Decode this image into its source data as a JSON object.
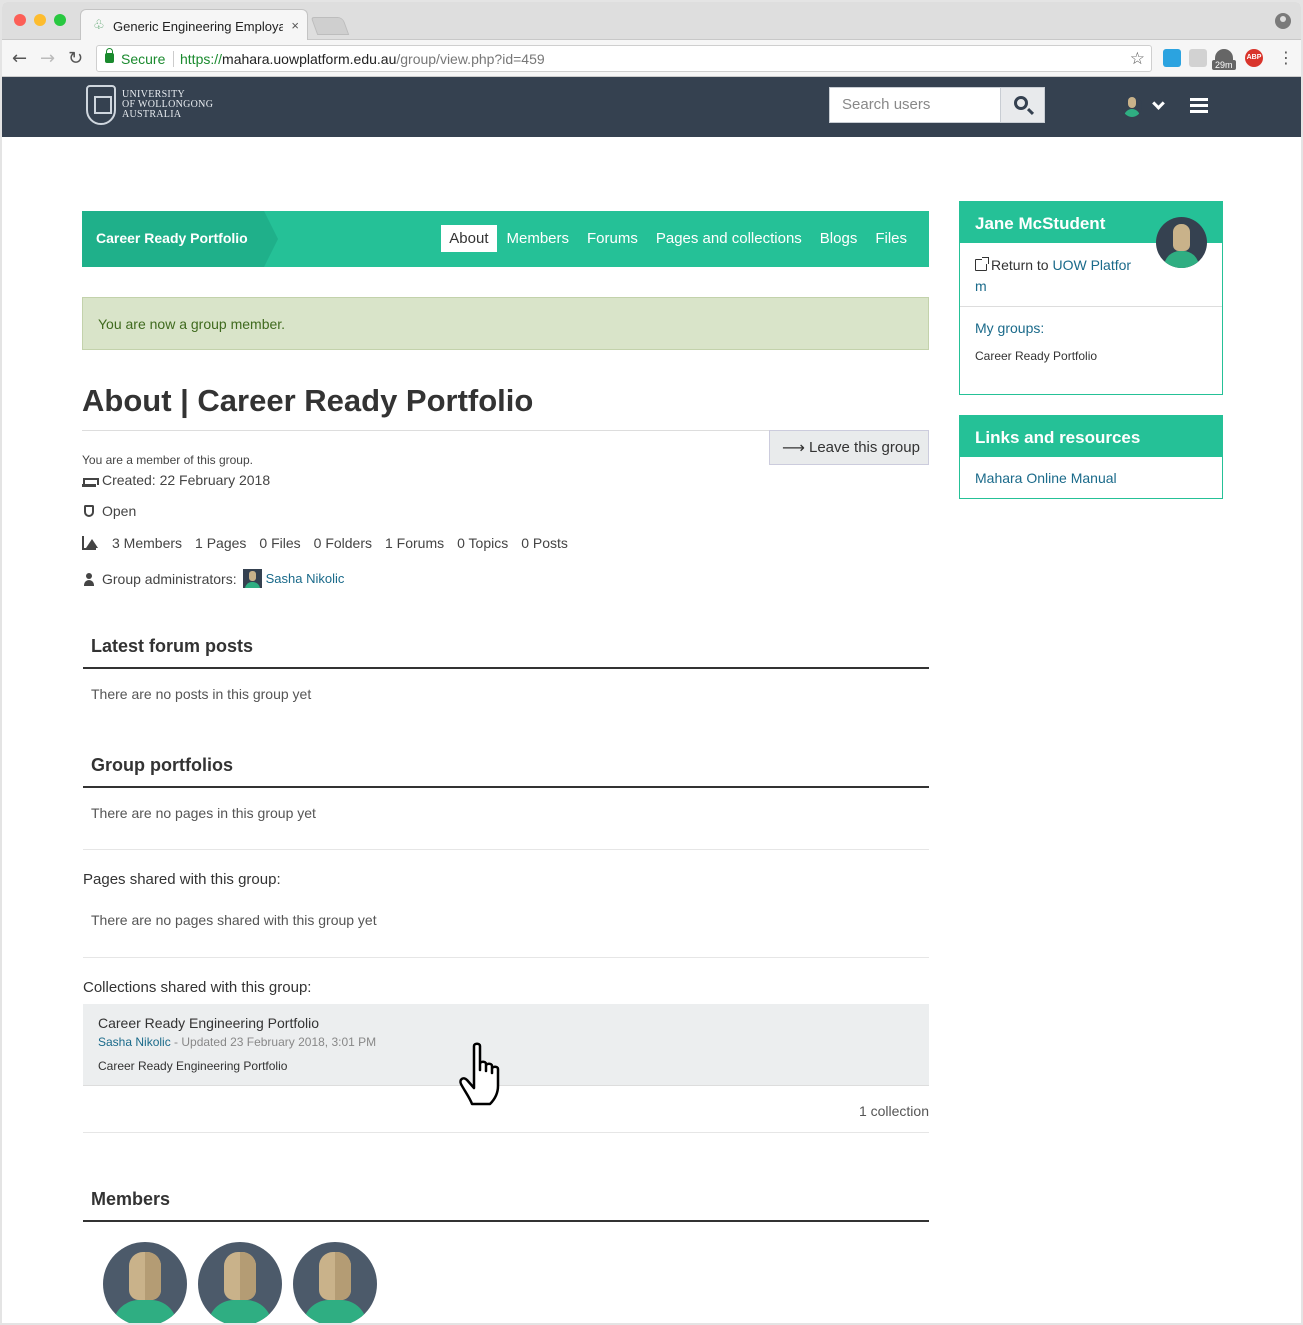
{
  "browser": {
    "tab_title": "Generic Engineering Employab",
    "tab_close": "×",
    "secure_label": "Secure",
    "url_proto": "https://",
    "url_host": "mahara.uowplatform.edu.au",
    "url_path": "/group/view.php?id=459",
    "ext_badge": "29m",
    "ext_abp": "ABP"
  },
  "header": {
    "logo_lines": [
      "UNIVERSITY",
      "OF WOLLONGONG",
      "AUSTRALIA"
    ],
    "search_placeholder": "Search users"
  },
  "group_nav": {
    "group_name": "Career Ready Portfolio",
    "tabs": [
      "About",
      "Members",
      "Forums",
      "Pages and collections",
      "Blogs",
      "Files"
    ],
    "active_tab": "About"
  },
  "alert": "You are now a group member.",
  "page_title": "About | Career Ready Portfolio",
  "leave_button": "Leave this group",
  "member_note": "You are a member of this group.",
  "created": "Created: 22 February 2018",
  "status": "Open",
  "stats": [
    "3 Members",
    "1 Pages",
    "0 Files",
    "0 Folders",
    "1 Forums",
    "0 Topics",
    "0 Posts"
  ],
  "group_admins_label": "Group administrators:",
  "group_admin_name": "Sasha Nikolic",
  "latest_forum": {
    "title": "Latest forum posts",
    "empty": "There are no posts in this group yet"
  },
  "group_portfolios": {
    "title": "Group portfolios",
    "empty": "There are no pages in this group yet",
    "shared_pages_label": "Pages shared with this group:",
    "shared_pages_empty": "There are no pages shared with this group yet",
    "shared_collections_label": "Collections shared with this group:",
    "collection": {
      "title": "Career Ready Engineering Portfolio",
      "author": "Sasha Nikolic",
      "updated": " - Updated 23 February 2018, 3:01 PM",
      "description": "Career Ready Engineering Portfolio"
    },
    "collection_count": "1 collection"
  },
  "members_section": {
    "title": "Members"
  },
  "sidebar": {
    "user_name": "Jane McStudent",
    "return_prefix": "Return to ",
    "return_link": "UOW Platfor",
    "return_link_wrap": "m",
    "my_groups_label": "My groups:",
    "my_groups_item": "Career Ready Portfolio",
    "links_title": "Links and resources",
    "manual_link": "Mahara Online Manual"
  }
}
